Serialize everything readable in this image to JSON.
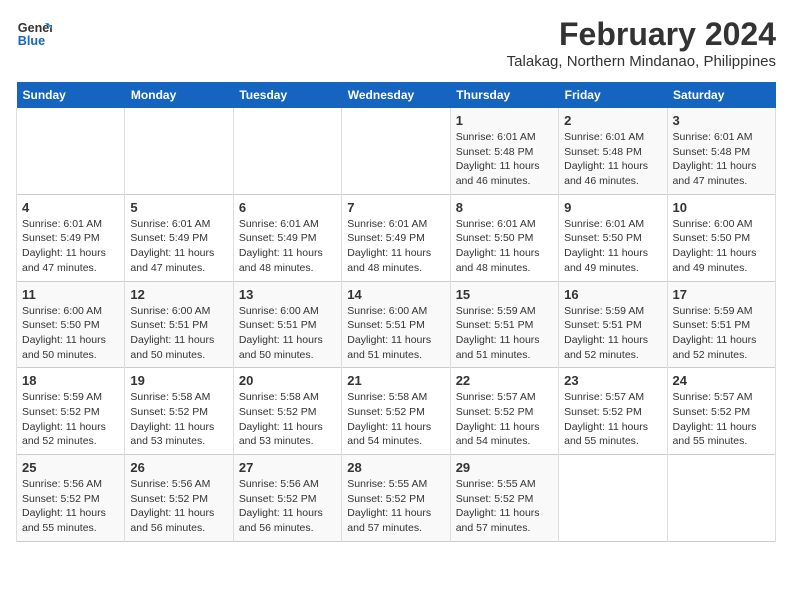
{
  "logo": {
    "line1": "General",
    "line2": "Blue"
  },
  "title": "February 2024",
  "subtitle": "Talakag, Northern Mindanao, Philippines",
  "days_of_week": [
    "Sunday",
    "Monday",
    "Tuesday",
    "Wednesday",
    "Thursday",
    "Friday",
    "Saturday"
  ],
  "weeks": [
    [
      {
        "day": "",
        "info": ""
      },
      {
        "day": "",
        "info": ""
      },
      {
        "day": "",
        "info": ""
      },
      {
        "day": "",
        "info": ""
      },
      {
        "day": "1",
        "info": "Sunrise: 6:01 AM\nSunset: 5:48 PM\nDaylight: 11 hours and 46 minutes."
      },
      {
        "day": "2",
        "info": "Sunrise: 6:01 AM\nSunset: 5:48 PM\nDaylight: 11 hours and 46 minutes."
      },
      {
        "day": "3",
        "info": "Sunrise: 6:01 AM\nSunset: 5:48 PM\nDaylight: 11 hours and 47 minutes."
      }
    ],
    [
      {
        "day": "4",
        "info": "Sunrise: 6:01 AM\nSunset: 5:49 PM\nDaylight: 11 hours and 47 minutes."
      },
      {
        "day": "5",
        "info": "Sunrise: 6:01 AM\nSunset: 5:49 PM\nDaylight: 11 hours and 47 minutes."
      },
      {
        "day": "6",
        "info": "Sunrise: 6:01 AM\nSunset: 5:49 PM\nDaylight: 11 hours and 48 minutes."
      },
      {
        "day": "7",
        "info": "Sunrise: 6:01 AM\nSunset: 5:49 PM\nDaylight: 11 hours and 48 minutes."
      },
      {
        "day": "8",
        "info": "Sunrise: 6:01 AM\nSunset: 5:50 PM\nDaylight: 11 hours and 48 minutes."
      },
      {
        "day": "9",
        "info": "Sunrise: 6:01 AM\nSunset: 5:50 PM\nDaylight: 11 hours and 49 minutes."
      },
      {
        "day": "10",
        "info": "Sunrise: 6:00 AM\nSunset: 5:50 PM\nDaylight: 11 hours and 49 minutes."
      }
    ],
    [
      {
        "day": "11",
        "info": "Sunrise: 6:00 AM\nSunset: 5:50 PM\nDaylight: 11 hours and 50 minutes."
      },
      {
        "day": "12",
        "info": "Sunrise: 6:00 AM\nSunset: 5:51 PM\nDaylight: 11 hours and 50 minutes."
      },
      {
        "day": "13",
        "info": "Sunrise: 6:00 AM\nSunset: 5:51 PM\nDaylight: 11 hours and 50 minutes."
      },
      {
        "day": "14",
        "info": "Sunrise: 6:00 AM\nSunset: 5:51 PM\nDaylight: 11 hours and 51 minutes."
      },
      {
        "day": "15",
        "info": "Sunrise: 5:59 AM\nSunset: 5:51 PM\nDaylight: 11 hours and 51 minutes."
      },
      {
        "day": "16",
        "info": "Sunrise: 5:59 AM\nSunset: 5:51 PM\nDaylight: 11 hours and 52 minutes."
      },
      {
        "day": "17",
        "info": "Sunrise: 5:59 AM\nSunset: 5:51 PM\nDaylight: 11 hours and 52 minutes."
      }
    ],
    [
      {
        "day": "18",
        "info": "Sunrise: 5:59 AM\nSunset: 5:52 PM\nDaylight: 11 hours and 52 minutes."
      },
      {
        "day": "19",
        "info": "Sunrise: 5:58 AM\nSunset: 5:52 PM\nDaylight: 11 hours and 53 minutes."
      },
      {
        "day": "20",
        "info": "Sunrise: 5:58 AM\nSunset: 5:52 PM\nDaylight: 11 hours and 53 minutes."
      },
      {
        "day": "21",
        "info": "Sunrise: 5:58 AM\nSunset: 5:52 PM\nDaylight: 11 hours and 54 minutes."
      },
      {
        "day": "22",
        "info": "Sunrise: 5:57 AM\nSunset: 5:52 PM\nDaylight: 11 hours and 54 minutes."
      },
      {
        "day": "23",
        "info": "Sunrise: 5:57 AM\nSunset: 5:52 PM\nDaylight: 11 hours and 55 minutes."
      },
      {
        "day": "24",
        "info": "Sunrise: 5:57 AM\nSunset: 5:52 PM\nDaylight: 11 hours and 55 minutes."
      }
    ],
    [
      {
        "day": "25",
        "info": "Sunrise: 5:56 AM\nSunset: 5:52 PM\nDaylight: 11 hours and 55 minutes."
      },
      {
        "day": "26",
        "info": "Sunrise: 5:56 AM\nSunset: 5:52 PM\nDaylight: 11 hours and 56 minutes."
      },
      {
        "day": "27",
        "info": "Sunrise: 5:56 AM\nSunset: 5:52 PM\nDaylight: 11 hours and 56 minutes."
      },
      {
        "day": "28",
        "info": "Sunrise: 5:55 AM\nSunset: 5:52 PM\nDaylight: 11 hours and 57 minutes."
      },
      {
        "day": "29",
        "info": "Sunrise: 5:55 AM\nSunset: 5:52 PM\nDaylight: 11 hours and 57 minutes."
      },
      {
        "day": "",
        "info": ""
      },
      {
        "day": "",
        "info": ""
      }
    ]
  ]
}
